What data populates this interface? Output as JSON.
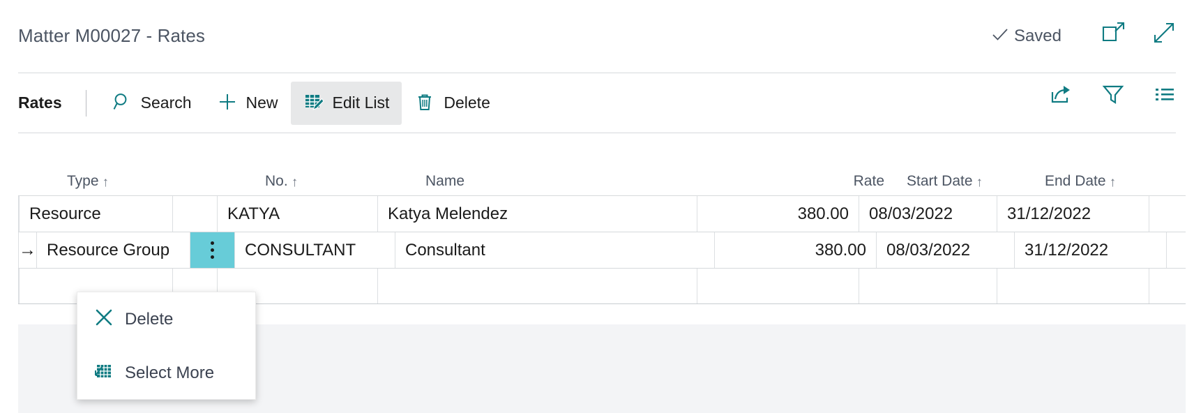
{
  "window": {
    "title": "Matter M00027 - Rates",
    "save_status": "Saved",
    "save_icon": "checkmark-icon",
    "open_new_window_icon": "open-in-new-window-icon",
    "expand_icon": "expand-fullscreen-icon"
  },
  "toolbar": {
    "section_title": "Rates",
    "actions": [
      {
        "label": "Search",
        "icon": "search-icon",
        "active": false
      },
      {
        "label": "New",
        "icon": "plus-icon",
        "active": false
      },
      {
        "label": "Edit List",
        "icon": "edit-list-icon",
        "active": true
      },
      {
        "label": "Delete",
        "icon": "trash-icon",
        "active": false
      }
    ],
    "right_icons": [
      {
        "name": "share-icon"
      },
      {
        "name": "filter-funnel-icon"
      },
      {
        "name": "list-options-icon"
      }
    ]
  },
  "table": {
    "columns": [
      {
        "key": "indicator",
        "label": "",
        "sort": "",
        "align": "center"
      },
      {
        "key": "type",
        "label": "Type",
        "sort": "↑",
        "align": "left"
      },
      {
        "key": "menu",
        "label": "",
        "sort": "",
        "align": "center"
      },
      {
        "key": "no",
        "label": "No.",
        "sort": "↑",
        "align": "left"
      },
      {
        "key": "name",
        "label": "Name",
        "sort": "",
        "align": "left"
      },
      {
        "key": "rate",
        "label": "Rate",
        "sort": "",
        "align": "right"
      },
      {
        "key": "startdate",
        "label": "Start Date",
        "sort": "↑",
        "align": "left"
      },
      {
        "key": "enddate",
        "label": "End Date",
        "sort": "↑",
        "align": "left"
      }
    ],
    "rows": [
      {
        "indicator": "",
        "type": "Resource",
        "no": "KATYA",
        "name": "Katya Melendez",
        "rate": "380.00",
        "startdate": "08/03/2022",
        "enddate": "31/12/2022",
        "selected": false
      },
      {
        "indicator": "→",
        "type": "Resource Group",
        "no": "CONSULTANT",
        "name": "Consultant",
        "rate": "380.00",
        "startdate": "08/03/2022",
        "enddate": "31/12/2022",
        "selected": true
      },
      {
        "indicator": "",
        "type": "",
        "no": "",
        "name": "",
        "rate": "",
        "startdate": "",
        "enddate": "",
        "selected": false
      }
    ]
  },
  "context_menu": {
    "items": [
      {
        "label": "Delete",
        "icon": "x-delete-icon"
      },
      {
        "label": "Select More",
        "icon": "select-more-icon"
      }
    ]
  },
  "colors": {
    "accent_teal": "#0f7b82",
    "selection_cyan": "#67ccd8",
    "title_text": "#4c5563",
    "body_text": "#1b1b1b",
    "toolbar_active_bg": "#e7e8e9",
    "footer_bg": "#f3f4f6",
    "grid_line": "#dcdfe2"
  }
}
